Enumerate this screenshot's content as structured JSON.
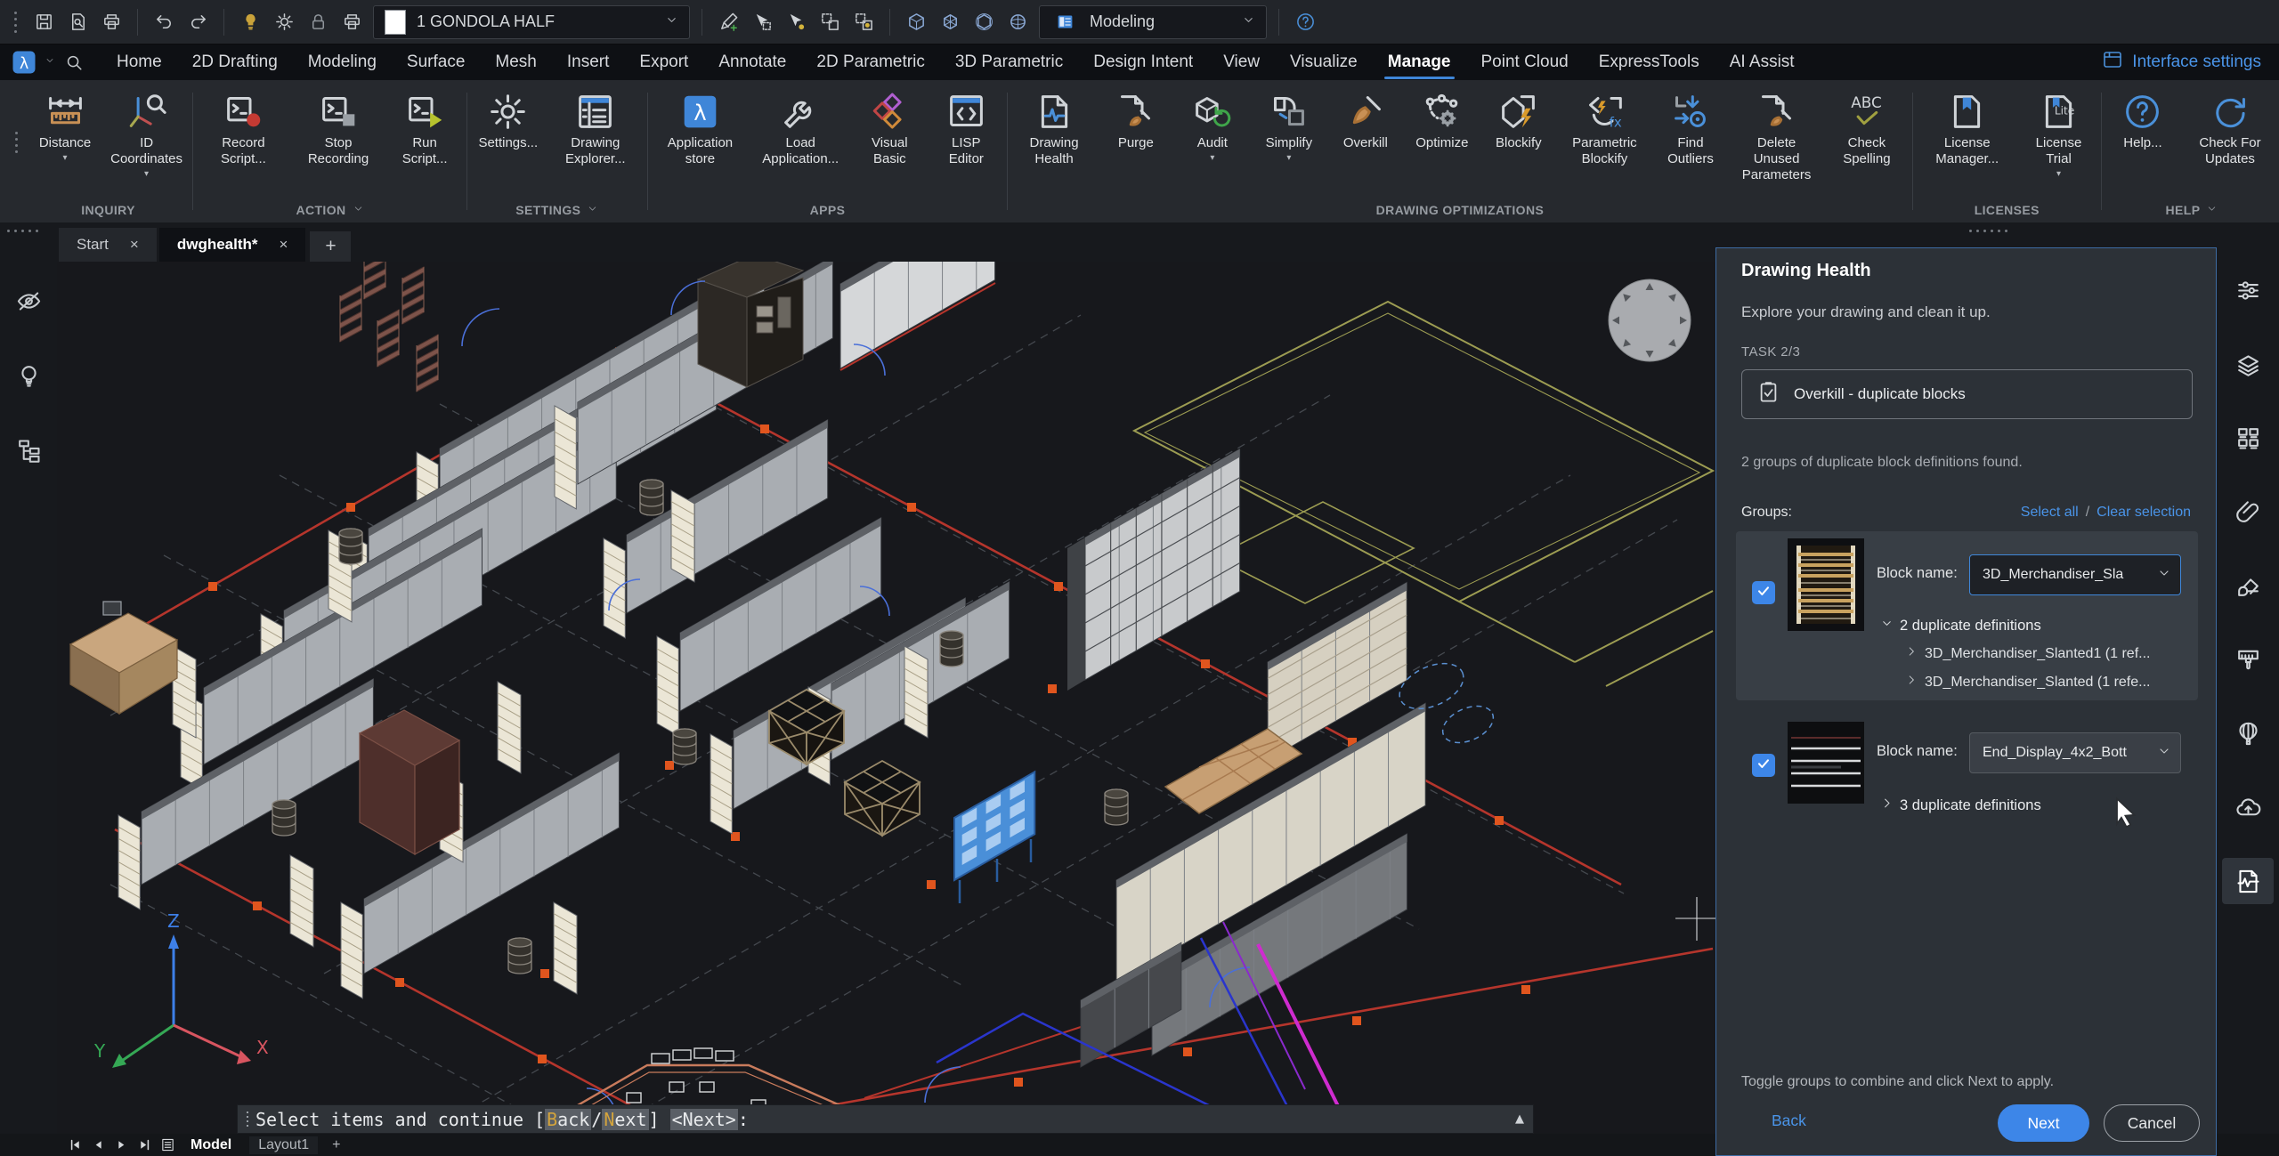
{
  "colors": {
    "accent_blue": "#3f86d8",
    "link_blue": "#4a94e8",
    "panel_border": "#3d6ba3",
    "panel_bg": "#2c3137",
    "card_bg": "#383e45",
    "checkbox_blue": "#3d86e8",
    "boundary_red": "#b5352c",
    "marker_orange": "#e0551e",
    "magenta_line": "#cf2bcf",
    "command_key_highlight": "#d4a43c"
  },
  "quick_access": {
    "drawing_layer": "1 GONDOLA HALF",
    "workspace": "Modeling",
    "icon_groups": {
      "file": [
        "save",
        "print-preview",
        "plot"
      ],
      "history": [
        "undo",
        "redo"
      ],
      "display": [
        "lamp-on",
        "brightness",
        "lock",
        "printer"
      ],
      "selection": [
        "pencil-add",
        "select-cursor",
        "select-brightness",
        "select-window",
        "select-window-brightness"
      ],
      "view": [
        "cube",
        "cube-alt",
        "cube-section",
        "cube-sphere"
      ]
    }
  },
  "menu": {
    "items": [
      "Home",
      "2D Drafting",
      "Modeling",
      "Surface",
      "Mesh",
      "Insert",
      "Export",
      "Annotate",
      "2D Parametric",
      "3D Parametric",
      "Design Intent",
      "View",
      "Visualize",
      "Manage",
      "Point Cloud",
      "ExpressTools",
      "AI Assist"
    ],
    "active": "Manage",
    "interface_settings": "Interface settings"
  },
  "ribbon": {
    "groups": [
      {
        "label": "INQUIRY",
        "chevron": false,
        "buttons": [
          {
            "label": "Distance",
            "icon": "distance",
            "arrow": true
          },
          {
            "label": "ID Coordinates",
            "icon": "id-coordinates",
            "arrow": true
          }
        ]
      },
      {
        "label": "ACTION",
        "chevron": true,
        "buttons": [
          {
            "label": "Record Script...",
            "icon": "record-script"
          },
          {
            "label": "Stop Recording",
            "icon": "stop-recording"
          },
          {
            "label": "Run Script...",
            "icon": "run-script"
          }
        ]
      },
      {
        "label": "SETTINGS",
        "chevron": true,
        "buttons": [
          {
            "label": "Settings...",
            "icon": "settings-gear"
          },
          {
            "label": "Drawing Explorer...",
            "icon": "drawing-explorer"
          }
        ]
      },
      {
        "label": "APPS",
        "chevron": false,
        "buttons": [
          {
            "label": "Application store",
            "icon": "application-store"
          },
          {
            "label": "Load Application...",
            "icon": "load-application"
          },
          {
            "label": "Visual Basic",
            "icon": "visual-basic"
          },
          {
            "label": "LISP Editor",
            "icon": "lisp-editor"
          }
        ]
      },
      {
        "label": "DRAWING OPTIMIZATIONS",
        "chevron": false,
        "buttons": [
          {
            "label": "Drawing Health",
            "icon": "drawing-health"
          },
          {
            "label": "Purge",
            "icon": "purge"
          },
          {
            "label": "Audit",
            "icon": "audit",
            "arrow": true
          },
          {
            "label": "Simplify",
            "icon": "simplify",
            "arrow": true
          },
          {
            "label": "Overkill",
            "icon": "overkill"
          },
          {
            "label": "Optimize",
            "icon": "optimize"
          },
          {
            "label": "Blockify",
            "icon": "blockify"
          },
          {
            "label": "Parametric Blockify",
            "icon": "parametric-blockify"
          },
          {
            "label": "Find Outliers",
            "icon": "find-outliers"
          },
          {
            "label": "Delete Unused Parameters",
            "icon": "delete-unused-parameters"
          },
          {
            "label": "Check Spelling",
            "icon": "check-spelling"
          }
        ]
      },
      {
        "label": "LICENSES",
        "chevron": false,
        "buttons": [
          {
            "label": "License Manager...",
            "icon": "license-manager"
          },
          {
            "label": "License Trial",
            "icon": "license-trial",
            "arrow": true
          }
        ]
      },
      {
        "label": "HELP",
        "chevron": true,
        "buttons": [
          {
            "label": "Help...",
            "icon": "help"
          },
          {
            "label": "Check For Updates",
            "icon": "check-updates"
          }
        ]
      }
    ]
  },
  "document_tabs": {
    "start": "Start",
    "active": "dwghealth*",
    "close_glyph": "×",
    "add_glyph": "+"
  },
  "panel": {
    "title": "Drawing Health",
    "subtitle": "Explore your drawing and clean it up.",
    "task_label": "TASK 2/3",
    "task_name": "Overkill - duplicate blocks",
    "found_text": "2 groups of duplicate block definitions found.",
    "groups_label": "Groups:",
    "select_all": "Select all",
    "link_separator": "/",
    "clear_selection": "Clear selection",
    "block_name_label": "Block name:",
    "groups": [
      {
        "checked": true,
        "block_name": "3D_Merchandiser_Sla",
        "dup_label": "2 duplicate definitions",
        "expanded": true,
        "definitions": [
          "3D_Merchandiser_Slanted1 (1 ref...",
          "3D_Merchandiser_Slanted (1 refe..."
        ]
      },
      {
        "checked": true,
        "block_name": "End_Display_4x2_Bott",
        "dup_label": "3 duplicate definitions",
        "expanded": false,
        "definitions": []
      }
    ],
    "footer_hint": "Toggle groups to combine and click Next to apply.",
    "back_label": "Back",
    "next_label": "Next",
    "cancel_label": "Cancel"
  },
  "command_line": {
    "before": "Select items and continue [",
    "back_key": "B",
    "back_rest": "ack",
    "slash": "/",
    "next_key": "N",
    "next_rest": "ext",
    "close": "] ",
    "default_option": "<Next>",
    "colon": ":"
  },
  "status_bar": {
    "model": "Model",
    "layout": "Layout1",
    "add_glyph": "+"
  },
  "canvas": {
    "ucs": {
      "x": "X",
      "y": "Y",
      "z": "Z"
    }
  },
  "left_toolbar": {
    "icons": [
      "visibility-off",
      "idea-bulb",
      "structure-tree"
    ]
  },
  "right_toolbar": {
    "icons": [
      {
        "name": "properties-sliders"
      },
      {
        "name": "layers"
      },
      {
        "name": "components-grid"
      },
      {
        "name": "attachments-paperclip"
      },
      {
        "name": "render-materials"
      },
      {
        "name": "paint-brush"
      },
      {
        "name": "air-balloon"
      },
      {
        "name": "cloud-upload"
      },
      {
        "name": "drawing-health-pulse",
        "active": true
      }
    ]
  }
}
